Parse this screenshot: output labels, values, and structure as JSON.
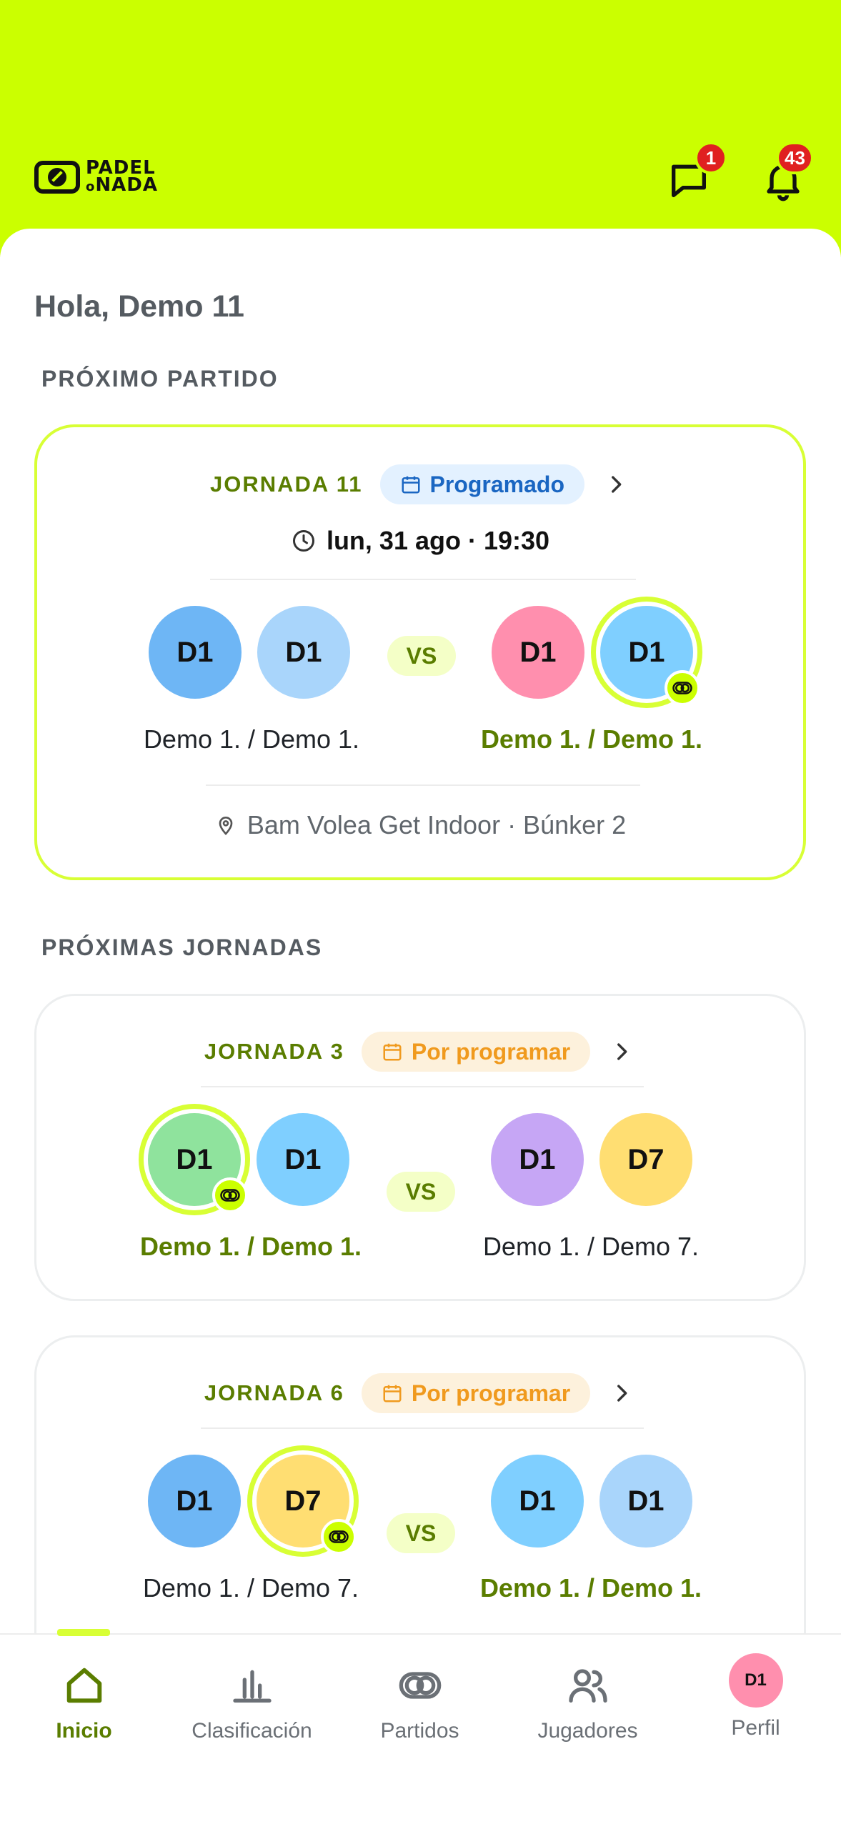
{
  "header": {
    "logo_line1": "PADEL",
    "logo_line2_small": "o",
    "logo_line2": "NADA",
    "messages_badge": "1",
    "notifications_badge": "43"
  },
  "greeting": "Hola, Demo 11",
  "next_match": {
    "section_title": "PRÓXIMO PARTIDO",
    "round": "JORNADA 11",
    "status": "Programado",
    "datetime": "lun, 31 ago · 19:30",
    "team_left": {
      "players": [
        "D1",
        "D1"
      ],
      "names": "Demo 1. / Demo 1."
    },
    "vs": "VS",
    "team_right": {
      "players": [
        "D1",
        "D1"
      ],
      "names": "Demo 1. / Demo 1."
    },
    "venue": "Bam Volea Get Indoor · Búnker 2"
  },
  "upcoming": {
    "section_title": "PRÓXIMAS JORNADAS",
    "rounds": [
      {
        "round": "JORNADA 3",
        "status": "Por programar",
        "team_left": {
          "players": [
            "D1",
            "D1"
          ],
          "names": "Demo 1. / Demo 1."
        },
        "vs": "VS",
        "team_right": {
          "players": [
            "D1",
            "D7"
          ],
          "names": "Demo 1. / Demo 7."
        }
      },
      {
        "round": "JORNADA 6",
        "status": "Por programar",
        "team_left": {
          "players": [
            "D1",
            "D7"
          ],
          "names": "Demo 1. / Demo 7."
        },
        "vs": "VS",
        "team_right": {
          "players": [
            "D1",
            "D1"
          ],
          "names": "Demo 1. / Demo 1."
        }
      }
    ]
  },
  "nav": {
    "inicio": "Inicio",
    "clasificacion": "Clasificación",
    "partidos": "Partidos",
    "jugadores": "Jugadores",
    "perfil": "Perfil",
    "perfil_avatar": "D1"
  },
  "colors": {
    "brand": "#cbff00",
    "accent_text": "#5a7d00",
    "status_blue": "#1a66c2",
    "status_orange": "#f09a1e"
  }
}
